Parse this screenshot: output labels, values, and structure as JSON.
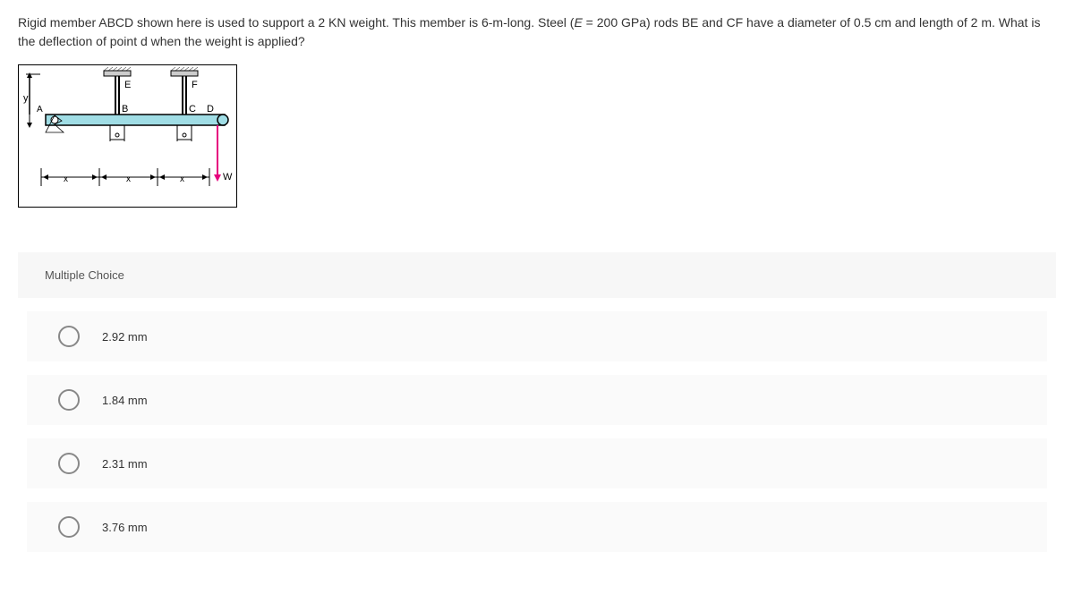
{
  "question": {
    "text_before_italic": "Rigid member ABCD shown here is used to support a 2 KN weight. This member is 6-m-long. Steel (",
    "italic_var": "E",
    "text_after_italic": " = 200 GPa) rods BE and CF have a diameter of 0.5 cm and length of 2 m. What is the deflection of point d when the weight is applied?"
  },
  "diagram": {
    "labels": {
      "y": "y",
      "A": "A",
      "B": "B",
      "C": "C",
      "D": "D",
      "E": "E",
      "F": "F",
      "W": "W",
      "x1": "x",
      "x2": "x",
      "x3": "x"
    }
  },
  "question_type": "Multiple Choice",
  "options": [
    {
      "label": "2.92 mm"
    },
    {
      "label": "1.84 mm"
    },
    {
      "label": "2.31 mm"
    },
    {
      "label": "3.76 mm"
    }
  ]
}
